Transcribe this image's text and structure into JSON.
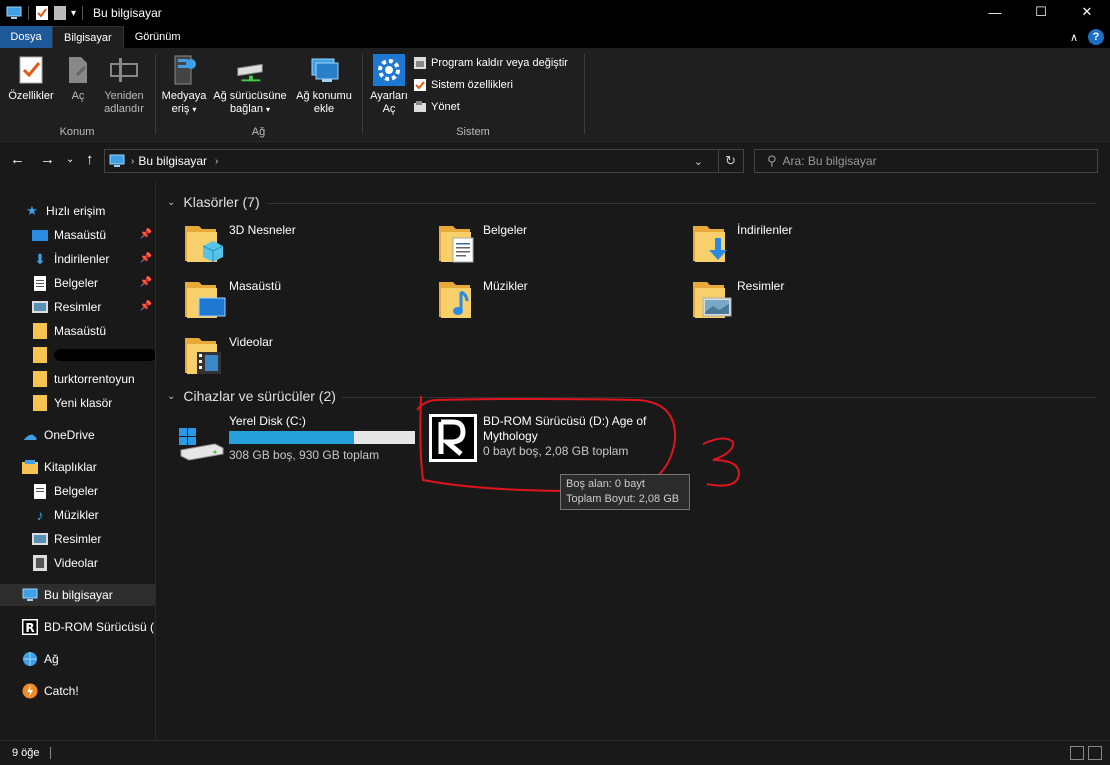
{
  "titlebar": {
    "title": "Bu bilgisayar",
    "minimize": "—",
    "maximize": "☐",
    "close": "✕"
  },
  "ribbon_tabs": {
    "file": "Dosya",
    "computer": "Bilgisayar",
    "view": "Görünüm"
  },
  "ribbon": {
    "groups": {
      "konum": "Konum",
      "ag": "Ağ",
      "sistem": "Sistem"
    },
    "properties": "Özellikler",
    "open": "Aç",
    "rename": "Yeniden adlandır",
    "media": "Medyaya erişim",
    "media_l1": "Medyaya",
    "media_l2": "eriş",
    "map_drive_l1": "Ağ sürücüsüne",
    "map_drive_l2": "bağlan",
    "add_net_l1": "Ağ konumu",
    "add_net_l2": "ekle",
    "settings_l1": "Ayarları",
    "settings_l2": "Aç",
    "rename_l1": "Yeniden",
    "rename_l2": "adlandır",
    "uninstall": "Program kaldır veya değiştir",
    "sys_props": "Sistem özellikleri",
    "manage": "Yönet"
  },
  "address": {
    "path": "Bu bilgisayar",
    "search_placeholder": "Ara: Bu bilgisayar"
  },
  "navpane": {
    "quick_access": "Hızlı erişim",
    "items": [
      "Masaüstü",
      "İndirilenler",
      "Belgeler",
      "Resimler",
      "Masaüstü",
      "",
      "turktorrentoyun",
      "Yeni klasör"
    ],
    "onedrive": "OneDrive",
    "libraries": "Kitaplıklar",
    "lib_items": [
      "Belgeler",
      "Müzikler",
      "Resimler",
      "Videolar"
    ],
    "this_pc": "Bu bilgisayar",
    "bd_rom": "BD-ROM Sürücüsü (D",
    "network": "Ağ",
    "catch": "Catch!"
  },
  "content": {
    "folders_header": "Klasörler (7)",
    "folders": [
      "3D Nesneler",
      "Belgeler",
      "İndirilenler",
      "Masaüstü",
      "Müzikler",
      "Resimler",
      "Videolar"
    ],
    "devices_header": "Cihazlar ve sürücüler (2)",
    "drive_c": {
      "name": "Yerel Disk (C:)",
      "free": "308 GB boş, 930 GB toplam",
      "used_fraction": 0.67
    },
    "drive_d": {
      "name_l1": "BD-ROM Sürücüsü (D:) Age of",
      "name_l2": "Mythology",
      "free": "0 bayt boş, 2,08 GB toplam"
    },
    "tooltip": {
      "line1": "Boş alan: 0 bayt",
      "line2": "Toplam Boyut: 2,08 GB"
    },
    "annotation": "3"
  },
  "statusbar": {
    "count": "9 öğe"
  },
  "colors": {
    "accent": "#1e5a9a",
    "annotation": "#e0141e",
    "bar": "#26a0da"
  }
}
